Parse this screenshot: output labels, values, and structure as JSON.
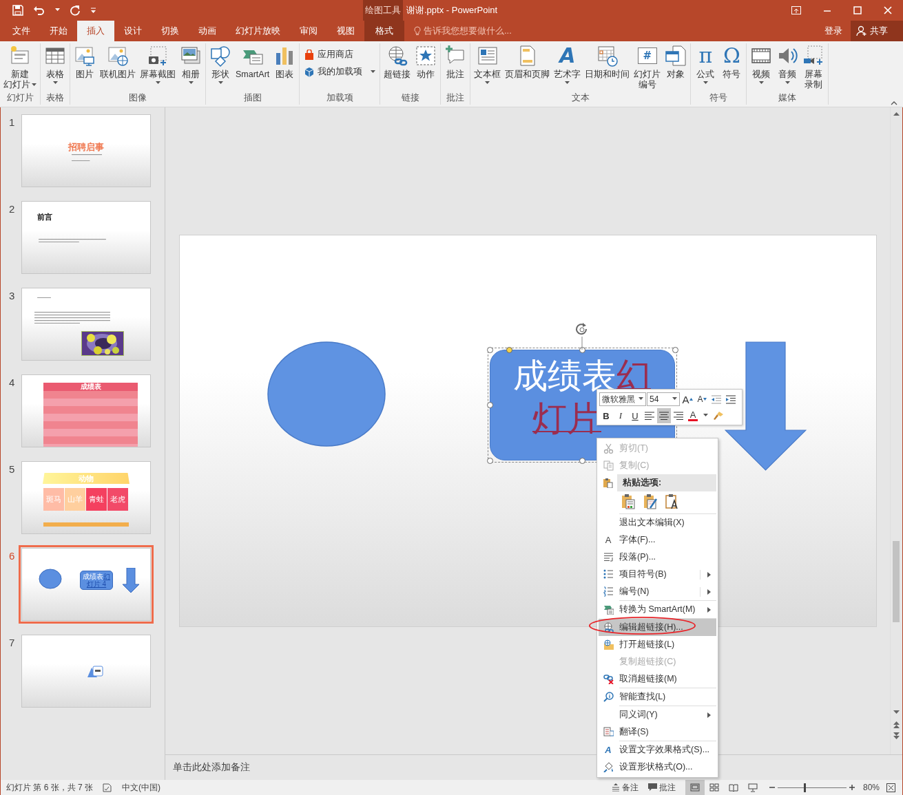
{
  "window": {
    "context_label": "绘图工具",
    "title": "谢谢.pptx - PowerPoint"
  },
  "tabs": [
    {
      "label": "文件",
      "kind": "file",
      "selected": false
    },
    {
      "label": "开始",
      "kind": "normal",
      "selected": false
    },
    {
      "label": "插入",
      "kind": "normal",
      "selected": true
    },
    {
      "label": "设计",
      "kind": "normal",
      "selected": false
    },
    {
      "label": "切换",
      "kind": "normal",
      "selected": false
    },
    {
      "label": "动画",
      "kind": "normal",
      "selected": false
    },
    {
      "label": "幻灯片放映",
      "kind": "normal",
      "selected": false
    },
    {
      "label": "审阅",
      "kind": "normal",
      "selected": false
    },
    {
      "label": "视图",
      "kind": "normal",
      "selected": false
    },
    {
      "label": "格式",
      "kind": "contextual",
      "selected": false
    }
  ],
  "tell_me": {
    "placeholder": "告诉我您想要做什么..."
  },
  "account": {
    "sign_in": "登录",
    "share": "共享"
  },
  "ribbon_groups": [
    {
      "label": "幻灯片",
      "buttons": [
        {
          "lines": [
            "新建",
            "幻灯片"
          ],
          "kind": "large",
          "dropdown": true
        }
      ]
    },
    {
      "label": "表格",
      "buttons": [
        {
          "label": "表格",
          "kind": "large",
          "dropdown": true
        }
      ]
    },
    {
      "label": "图像",
      "buttons": [
        {
          "label": "图片",
          "kind": "large",
          "dropdown": false
        },
        {
          "label": "联机图片",
          "kind": "large",
          "dropdown": false
        },
        {
          "label": "屏幕截图",
          "kind": "large",
          "dropdown": true
        },
        {
          "label": "相册",
          "kind": "large",
          "dropdown": true
        }
      ]
    },
    {
      "label": "插图",
      "buttons": [
        {
          "label": "形状",
          "kind": "large",
          "dropdown": true
        },
        {
          "label": "SmartArt",
          "kind": "large",
          "dropdown": false
        },
        {
          "label": "图表",
          "kind": "large",
          "dropdown": false
        }
      ]
    },
    {
      "label": "加载项",
      "buttons": [
        {
          "label": "应用商店",
          "kind": "small",
          "dropdown": false
        },
        {
          "label": "我的加载项",
          "kind": "small",
          "dropdown": true
        }
      ]
    },
    {
      "label": "链接",
      "buttons": [
        {
          "label": "超链接",
          "kind": "large",
          "dropdown": false
        },
        {
          "label": "动作",
          "kind": "large",
          "dropdown": false
        }
      ]
    },
    {
      "label": "批注",
      "buttons": [
        {
          "label": "批注",
          "kind": "large",
          "dropdown": false
        }
      ]
    },
    {
      "label": "文本",
      "buttons": [
        {
          "label": "文本框",
          "kind": "large",
          "dropdown": true
        },
        {
          "label": "页眉和页脚",
          "kind": "large",
          "dropdown": false
        },
        {
          "label": "艺术字",
          "kind": "large",
          "dropdown": true,
          "glyph": "A"
        },
        {
          "label": "日期和时间",
          "kind": "large",
          "dropdown": false
        },
        {
          "lines": [
            "幻灯片",
            "编号"
          ],
          "kind": "large",
          "dropdown": false,
          "glyph": "#"
        },
        {
          "label": "对象",
          "kind": "large",
          "dropdown": false
        }
      ]
    },
    {
      "label": "符号",
      "buttons": [
        {
          "label": "公式",
          "kind": "large",
          "dropdown": true,
          "glyph": "π"
        },
        {
          "label": "符号",
          "kind": "large",
          "dropdown": false,
          "glyph": "Ω"
        }
      ]
    },
    {
      "label": "媒体",
      "buttons": [
        {
          "label": "视频",
          "kind": "large",
          "dropdown": true
        },
        {
          "label": "音频",
          "kind": "large",
          "dropdown": true
        },
        {
          "lines": [
            "屏幕",
            "录制"
          ],
          "kind": "large",
          "dropdown": false
        }
      ]
    }
  ],
  "slides": [
    {
      "number": "1",
      "selected": false,
      "kind": "title",
      "title": "招聘启事"
    },
    {
      "number": "2",
      "selected": false,
      "kind": "text",
      "title": "前言"
    },
    {
      "number": "3",
      "selected": false,
      "kind": "picture"
    },
    {
      "number": "4",
      "selected": false,
      "kind": "table",
      "title": "成绩表"
    },
    {
      "number": "5",
      "selected": false,
      "kind": "animals",
      "title": "动物",
      "tiles": [
        {
          "text": "斑马",
          "color": "#ffbca6"
        },
        {
          "text": "山羊",
          "color": "#ffcf9e"
        },
        {
          "text": "青蛙",
          "color": "#f4405f"
        },
        {
          "text": "老虎",
          "color": "#f24a68"
        }
      ]
    },
    {
      "number": "6",
      "selected": true,
      "kind": "shapes",
      "text": "成绩表",
      "link": "幻灯片 4"
    },
    {
      "number": "7",
      "selected": false,
      "kind": "icon"
    }
  ],
  "slide": {
    "shapes": [
      {
        "kind": "ellipse"
      },
      {
        "kind": "text-box",
        "lines": [
          {
            "text": "成绩表",
            "link": "幻"
          },
          {
            "link": "灯片"
          }
        ],
        "selected": true
      },
      {
        "kind": "down-arrow"
      }
    ]
  },
  "mini_toolbar": {
    "font": "微软雅黑",
    "size": "54",
    "buttons": [
      {
        "kind": "grow",
        "label": "A",
        "selected": false
      },
      {
        "kind": "shrink",
        "label": "A",
        "selected": false
      },
      {
        "kind": "outdent",
        "selected": false
      },
      {
        "kind": "indent",
        "selected": false
      },
      {
        "kind": "bold",
        "label": "B",
        "selected": false
      },
      {
        "kind": "italic",
        "label": "I",
        "selected": false
      },
      {
        "kind": "underline",
        "label": "U",
        "selected": false
      },
      {
        "kind": "align-left",
        "selected": false
      },
      {
        "kind": "align-center",
        "selected": true
      },
      {
        "kind": "align-right",
        "selected": false
      },
      {
        "kind": "font-color",
        "label": "A",
        "color": "#e81123",
        "selected": false
      },
      {
        "kind": "format-painter",
        "selected": false
      }
    ]
  },
  "context_menu": [
    {
      "kind": "item",
      "label": "剪切(T)",
      "disabled": true,
      "submenu": false,
      "selected": false
    },
    {
      "kind": "item",
      "label": "复制(C)",
      "disabled": true,
      "submenu": false,
      "selected": false
    },
    {
      "kind": "header",
      "label": "粘贴选项:"
    },
    {
      "kind": "paste-icons"
    },
    {
      "kind": "separator"
    },
    {
      "kind": "item",
      "label": "退出文本编辑(X)",
      "disabled": false,
      "submenu": false,
      "selected": false
    },
    {
      "kind": "item",
      "label": "字体(F)...",
      "glyph": "A",
      "disabled": false,
      "submenu": false,
      "selected": false
    },
    {
      "kind": "item",
      "label": "段落(P)...",
      "disabled": false,
      "submenu": false,
      "selected": false
    },
    {
      "kind": "item",
      "label": "项目符号(B)",
      "disabled": false,
      "submenu": true,
      "selected": false
    },
    {
      "kind": "item",
      "label": "编号(N)",
      "disabled": false,
      "submenu": true,
      "selected": false
    },
    {
      "kind": "separator"
    },
    {
      "kind": "item",
      "label": "转换为 SmartArt(M)",
      "disabled": false,
      "submenu": true,
      "selected": false
    },
    {
      "kind": "separator"
    },
    {
      "kind": "item",
      "label": "编辑超链接(H)...",
      "disabled": false,
      "submenu": false,
      "selected": true
    },
    {
      "kind": "item",
      "label": "打开超链接(L)",
      "disabled": false,
      "submenu": false,
      "selected": false
    },
    {
      "kind": "item",
      "label": "复制超链接(C)",
      "disabled": true,
      "submenu": false,
      "selected": false
    },
    {
      "kind": "item",
      "label": "取消超链接(M)",
      "disabled": false,
      "submenu": false,
      "selected": false
    },
    {
      "kind": "separator"
    },
    {
      "kind": "item",
      "label": "智能查找(L)",
      "disabled": false,
      "submenu": false,
      "selected": false
    },
    {
      "kind": "separator"
    },
    {
      "kind": "item",
      "label": "同义词(Y)",
      "disabled": false,
      "submenu": true,
      "selected": false
    },
    {
      "kind": "item",
      "label": "翻译(S)",
      "disabled": false,
      "submenu": false,
      "selected": false
    },
    {
      "kind": "separator"
    },
    {
      "kind": "item",
      "label": "设置文字效果格式(S)...",
      "glyph": "A",
      "disabled": false,
      "submenu": false,
      "selected": false
    },
    {
      "kind": "item",
      "label": "设置形状格式(O)...",
      "disabled": false,
      "submenu": false,
      "selected": false
    }
  ],
  "notes": {
    "placeholder": "单击此处添加备注"
  },
  "status_bar": {
    "slide_info": "幻灯片 第 6 张，共 7 张",
    "language": "中文(中国)",
    "notes": "备注",
    "comments": "批注",
    "views": [
      {
        "selected": true
      },
      {
        "selected": false
      },
      {
        "selected": false
      },
      {
        "selected": false
      }
    ],
    "zoom": {
      "level": 0.4,
      "reading": "80%"
    }
  }
}
